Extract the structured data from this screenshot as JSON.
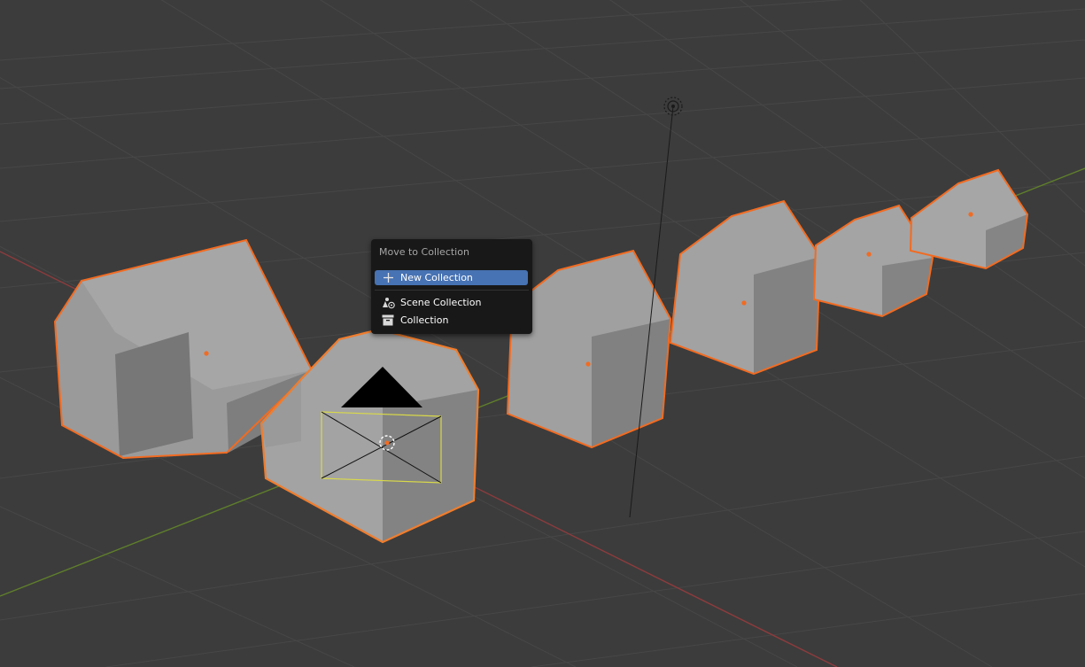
{
  "move_menu": {
    "title": "Move to Collection",
    "items": [
      {
        "label": "New Collection",
        "icon": "plus-icon",
        "active": true
      },
      {
        "label": "Scene Collection",
        "icon": "scene-collection-icon",
        "active": false
      },
      {
        "label": "Collection",
        "icon": "collection-icon",
        "active": false
      }
    ]
  },
  "theme": {
    "viewport_bg": "#3c3c3c",
    "grid_line": "#454545",
    "x_axis": "#9b3b3d",
    "y_axis": "#6b8c2f",
    "selection_outline": "#f26b21",
    "object_face_light": "#a2a2a2",
    "object_face_dark": "#7f7f7f",
    "menu_bg": "#181818",
    "menu_highlight": "#4772b3"
  }
}
